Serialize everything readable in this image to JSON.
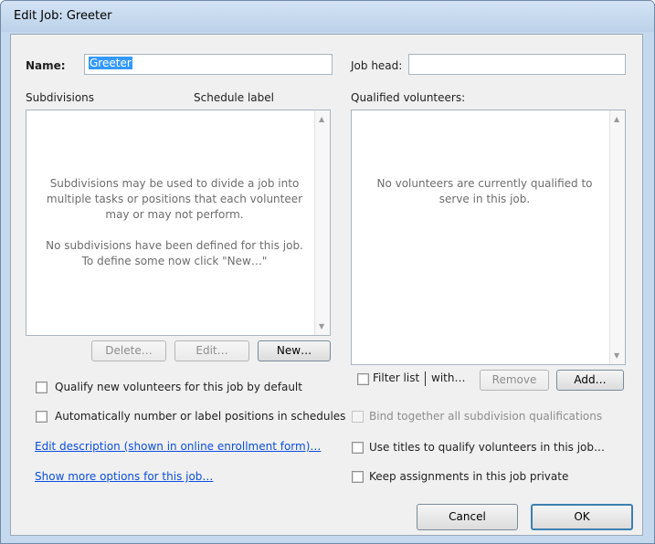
{
  "window": {
    "title": "Edit Job: Greeter"
  },
  "name": {
    "label": "Name:",
    "value": "Greeter"
  },
  "job_head": {
    "label": "Job head:",
    "value": ""
  },
  "subdivisions": {
    "header": "Subdivisions",
    "schedule_label_header": "Schedule label",
    "empty_text_1": "Subdivisions may be used to divide a job into multiple tasks or positions that each volunteer may or may not perform.",
    "empty_text_2": "No subdivisions have been defined for this job. To define some now click \"New…\"",
    "delete_label": "Delete…",
    "edit_label": "Edit…",
    "new_label": "New…"
  },
  "qualified": {
    "header": "Qualified volunteers:",
    "empty_text": "No volunteers are currently qualified to serve in this job.",
    "filter_label": "Filter list",
    "with_label": "with…",
    "remove_label": "Remove",
    "add_label": "Add…"
  },
  "options": {
    "qualify_new": "Qualify new volunteers for this job by default",
    "auto_number": "Automatically number or label positions in schedules",
    "edit_description": "Edit description (shown in online enrollment form)…",
    "show_more": "Show more options for this job…",
    "bind_together": "Bind together all subdivision qualifications",
    "use_titles": "Use titles to qualify volunteers in this job…",
    "keep_private": "Keep assignments in this job private"
  },
  "buttons": {
    "cancel": "Cancel",
    "ok": "OK"
  }
}
